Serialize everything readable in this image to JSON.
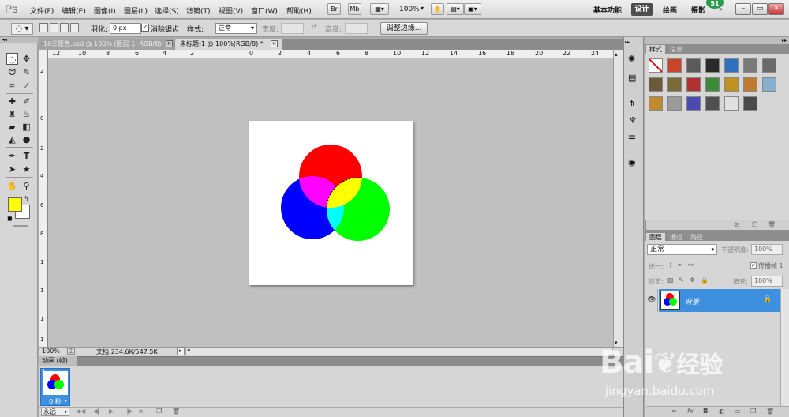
{
  "app": {
    "logo": "Ps"
  },
  "menus": [
    "文件(F)",
    "编辑(E)",
    "图像(I)",
    "图层(L)",
    "选择(S)",
    "滤镜(T)",
    "视图(V)",
    "窗口(W)",
    "帮助(H)"
  ],
  "appbar": {
    "br": "Br",
    "mb": "Mb",
    "zoom": "100%"
  },
  "workspaces": {
    "basic": "基本功能",
    "design": "设计",
    "paint": "绘画",
    "photo": "摄影",
    "badge": "51"
  },
  "options": {
    "feather_label": "羽化:",
    "feather_value": "0 px",
    "antialias_label": "消除锯齿",
    "style_label": "样式:",
    "style_value": "正常",
    "width_label": "宽度:",
    "height_label": "高度:",
    "refine_button": "调整边缘..."
  },
  "tabs": [
    {
      "label": "10三原色.psd @ 100% (图层 1, RGB/8)",
      "active": false
    },
    {
      "label": "未标题-1 @ 100%(RGB/8) *",
      "active": true
    }
  ],
  "ruler": {
    "top": [
      "12",
      "10",
      "8",
      "6",
      "4",
      "2",
      "0",
      "2",
      "4",
      "6",
      "8",
      "10",
      "12",
      "14",
      "16",
      "18",
      "20",
      "22",
      "24"
    ],
    "left": [
      "2",
      "0",
      "2",
      "4",
      "6",
      "8",
      "1",
      "1",
      "1",
      "1"
    ]
  },
  "status": {
    "zoom": "100%",
    "doc": "文档:234.6K/547.5K"
  },
  "colors": {
    "foreground": "#ffff00",
    "background": "#ffffff",
    "red": "#ff0000",
    "green": "#00ff00",
    "blue": "#0000ff",
    "magenta": "#ff00ff",
    "yellow": "#ffff00",
    "cyan": "#00ffff"
  },
  "animation": {
    "title": "动画 (帧)",
    "frame_number": "1",
    "frame_delay": "0 秒",
    "loop": "永远"
  },
  "panels": {
    "styles_tab": "样式",
    "info_tab": "信息",
    "layers_tab": "图层",
    "channels_tab": "通道",
    "paths_tab": "路径",
    "blend_mode": "正常",
    "opacity_label": "不透明度:",
    "opacity_value": "100%",
    "unify_label": "统一:",
    "propagate_label": "传播帧 1",
    "lock_label": "锁定:",
    "fill_label": "填充:",
    "fill_value": "100%",
    "layer_name": "背景"
  },
  "watermark": {
    "brand": "Bai",
    "brand_cn": "经验",
    "url": "jingyan.baidu.com"
  }
}
